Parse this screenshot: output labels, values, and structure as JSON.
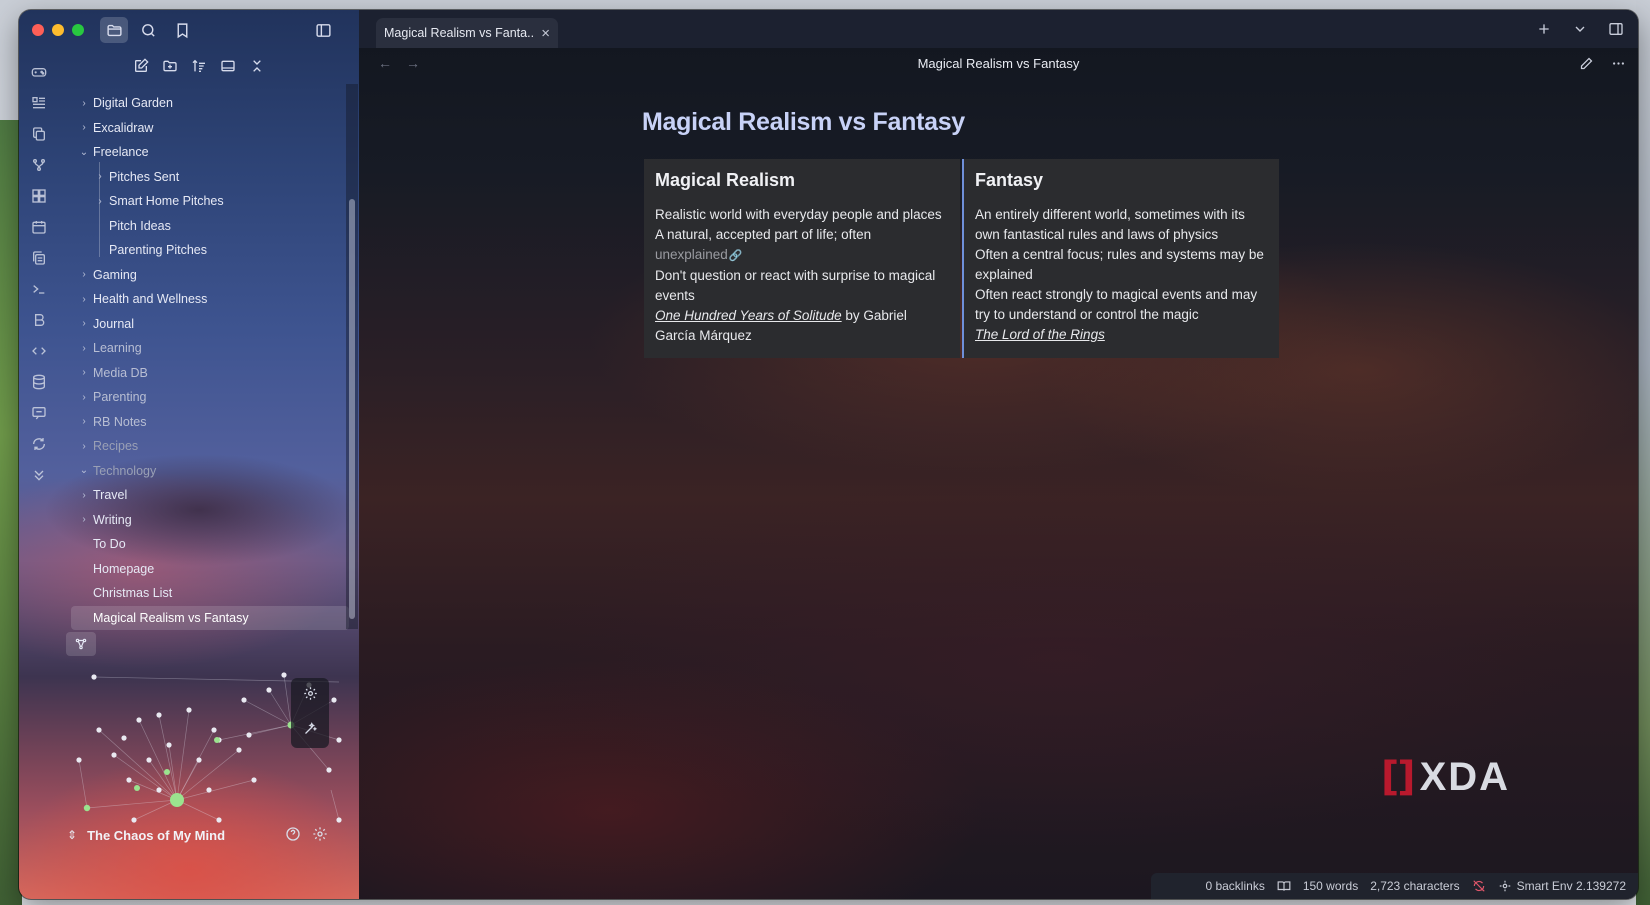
{
  "window": {
    "tab_title": "Magical Realism vs Fanta...",
    "view_title": "Magical Realism vs Fantasy"
  },
  "ribbon": {
    "icons": [
      "gamepad-icon",
      "kanban-icon",
      "copy-notes-icon",
      "git-branch-icon",
      "dashboard-icon",
      "calendar-icon",
      "pages-icon",
      "terminal-icon",
      "bold-icon",
      "templater-icon",
      "database-icon",
      "chat-icon",
      "sync-icon",
      "chevrons-down-icon"
    ]
  },
  "file_tree": {
    "items": [
      {
        "label": "Digital Garden",
        "level": 0,
        "chevron": "right"
      },
      {
        "label": "Excalidraw",
        "level": 0,
        "chevron": "right"
      },
      {
        "label": "Freelance",
        "level": 0,
        "chevron": "down"
      },
      {
        "label": "Pitches Sent",
        "level": 1,
        "chevron": "right"
      },
      {
        "label": "Smart Home Pitches",
        "level": 1,
        "chevron": "right"
      },
      {
        "label": "Pitch Ideas",
        "level": 1,
        "chevron": "none"
      },
      {
        "label": "Parenting Pitches",
        "level": 1,
        "chevron": "none"
      },
      {
        "label": "Gaming",
        "level": 0,
        "chevron": "right"
      },
      {
        "label": "Health and Wellness",
        "level": 0,
        "chevron": "right"
      },
      {
        "label": "Journal",
        "level": 0,
        "chevron": "right"
      },
      {
        "label": "Learning",
        "level": 0,
        "chevron": "right"
      },
      {
        "label": "Media DB",
        "level": 0,
        "chevron": "right"
      },
      {
        "label": "Parenting",
        "level": 0,
        "chevron": "right"
      },
      {
        "label": "RB Notes",
        "level": 0,
        "chevron": "right"
      },
      {
        "label": "Recipes",
        "level": 0,
        "chevron": "right"
      },
      {
        "label": "Technology",
        "level": 0,
        "chevron": "down"
      },
      {
        "label": "Travel",
        "level": 0,
        "chevron": "right"
      },
      {
        "label": "Writing",
        "level": 0,
        "chevron": "right"
      },
      {
        "label": "To Do",
        "level": 0,
        "chevron": "none"
      },
      {
        "label": "Homepage",
        "level": 0,
        "chevron": "none"
      },
      {
        "label": "Christmas List",
        "level": 0,
        "chevron": "none"
      },
      {
        "label": "Magical Realism vs Fantasy",
        "level": 0,
        "chevron": "none",
        "active": true
      }
    ]
  },
  "vault": {
    "name": "The Chaos of My Mind"
  },
  "note": {
    "title": "Magical Realism vs Fantasy",
    "columns": [
      {
        "heading": "Magical Realism",
        "rows": [
          "Realistic world with everyday people and places",
          "A natural, accepted part of life; often",
          "unexplained",
          "Don't question or react with surprise to magical events",
          "One Hundred Years of Solitude",
          " by Gabriel García Márquez"
        ]
      },
      {
        "heading": "Fantasy",
        "rows": [
          "An entirely different world, sometimes with its own fantastical rules and laws of physics",
          "Often a central focus; rules and systems may be explained",
          "Often react strongly to magical events and may try to understand or control the magic",
          "The Lord of the Rings"
        ]
      }
    ]
  },
  "watermark": {
    "bracket": "[]",
    "brand": "XDA"
  },
  "status_bar": {
    "backlinks": "0 backlinks",
    "words": "150 words",
    "characters": "2,723 characters",
    "smart_env": "Smart Env 2.139272"
  },
  "colors": {
    "accent": "#6f8fd9",
    "title": "#c8d2f7",
    "graph_node": "#9be38e",
    "traffic_red": "#fe5f57",
    "traffic_yellow": "#febc2e",
    "traffic_green": "#28c840"
  }
}
